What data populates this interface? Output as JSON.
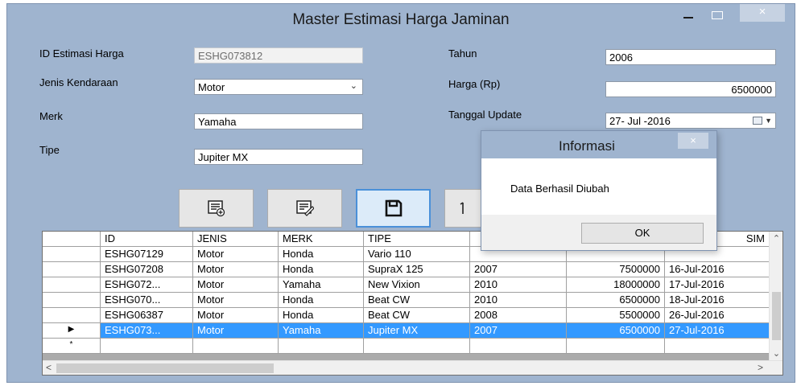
{
  "window": {
    "title": "Master Estimasi Harga Jaminan",
    "close_glyph": "×"
  },
  "form": {
    "id_label": "ID Estimasi Harga",
    "id_value": "ESHG073812",
    "jenis_label": "Jenis Kendaraan",
    "jenis_value": "Motor",
    "merk_label": "Merk",
    "merk_value": "Yamaha",
    "tipe_label": "Tipe",
    "tipe_value": "Jupiter MX",
    "tahun_label": "Tahun",
    "tahun_value": "2006",
    "harga_label": "Harga (Rp)",
    "harga_value": "6500000",
    "tanggal_label": "Tanggal Update",
    "tanggal_value": "27- Jul -2016"
  },
  "toolbar": {
    "buttons": [
      {
        "icon": "add-record-icon"
      },
      {
        "icon": "edit-record-icon"
      },
      {
        "icon": "save-icon"
      },
      {
        "icon": "delete-icon"
      }
    ]
  },
  "grid": {
    "columns": [
      "ID",
      "JENIS",
      "MERK",
      "TIPE",
      "",
      "",
      "SIM"
    ],
    "rows": [
      {
        "marker": "",
        "cells": [
          "ESHG07129",
          "Motor",
          "Honda",
          "Vario 110",
          "",
          "",
          ""
        ]
      },
      {
        "marker": "",
        "cells": [
          "ESHG07208",
          "Motor",
          "Honda",
          "SupraX 125",
          "2007",
          "7500000",
          "16-Jul-2016"
        ]
      },
      {
        "marker": "",
        "cells": [
          "ESHG072...",
          "Motor",
          "Yamaha",
          "New Vixion",
          "2010",
          "18000000",
          "17-Jul-2016"
        ]
      },
      {
        "marker": "",
        "cells": [
          "ESHG070...",
          "Motor",
          "Honda",
          "Beat CW",
          "2010",
          "6500000",
          "18-Jul-2016"
        ]
      },
      {
        "marker": "",
        "cells": [
          "ESHG06387",
          "Motor",
          "Honda",
          "Beat CW",
          "2008",
          "5500000",
          "26-Jul-2016"
        ]
      },
      {
        "marker": "▶",
        "cells": [
          "ESHG073...",
          "Motor",
          "Yamaha",
          "Jupiter MX",
          "2007",
          "6500000",
          "27-Jul-2016"
        ]
      }
    ],
    "new_row_marker": "*"
  },
  "dialog": {
    "title": "Informasi",
    "message": "Data Berhasil Diubah",
    "ok_label": "OK",
    "close_glyph": "×"
  },
  "colors": {
    "window_bg": "#9fb4cf",
    "selection": "#3399ff"
  }
}
